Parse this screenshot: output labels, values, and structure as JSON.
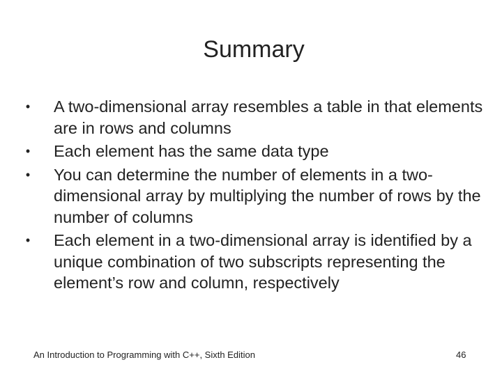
{
  "slide": {
    "title": "Summary",
    "bullets": [
      "A two-dimensional array resembles a table in that elements are in rows and columns",
      "Each element has the same data type",
      "You can determine the number of elements in a two-dimensional array by multiplying the number of rows by the number of columns",
      "Each element in a two-dimensional array is identified by a unique combination of two subscripts representing the element’s row and column, respectively"
    ],
    "bullet_glyph": "•"
  },
  "footer": {
    "book_title": "An Introduction to Programming with C++, Sixth Edition",
    "page_number": "46"
  }
}
